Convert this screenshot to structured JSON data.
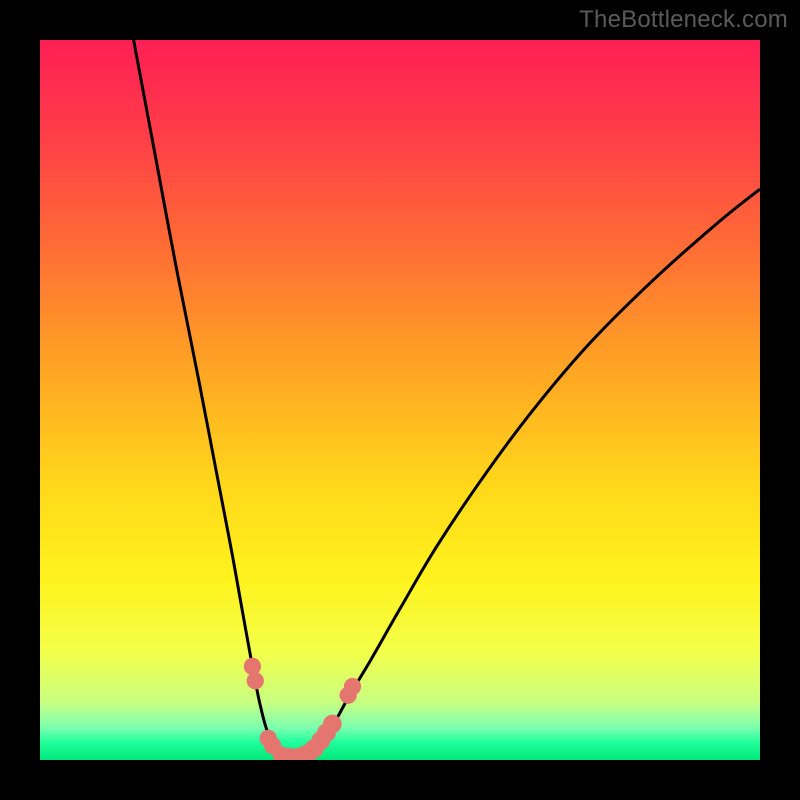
{
  "watermark": "TheBottleneck.com",
  "colors": {
    "frame": "#000000",
    "curve": "#000000",
    "marker": "#e4756f",
    "gradient_stops": [
      {
        "offset": 0.0,
        "color": "#ff1f55"
      },
      {
        "offset": 0.12,
        "color": "#ff3a4a"
      },
      {
        "offset": 0.28,
        "color": "#ff6a36"
      },
      {
        "offset": 0.45,
        "color": "#ffa324"
      },
      {
        "offset": 0.62,
        "color": "#ffd81a"
      },
      {
        "offset": 0.75,
        "color": "#fff31e"
      },
      {
        "offset": 0.85,
        "color": "#f3ff4a"
      },
      {
        "offset": 0.92,
        "color": "#c8ff82"
      },
      {
        "offset": 0.955,
        "color": "#7dffb0"
      },
      {
        "offset": 0.975,
        "color": "#22ff9d"
      },
      {
        "offset": 1.0,
        "color": "#00e87a"
      }
    ]
  },
  "chart_data": {
    "type": "line",
    "title": "",
    "xlabel": "",
    "ylabel": "",
    "xlim": [
      0,
      100
    ],
    "ylim": [
      0,
      100
    ],
    "series": [
      {
        "name": "left-curve",
        "points": [
          {
            "x": 13.0,
            "y": 100.0
          },
          {
            "x": 16.0,
            "y": 84.0
          },
          {
            "x": 19.0,
            "y": 68.0
          },
          {
            "x": 22.0,
            "y": 53.0
          },
          {
            "x": 24.5,
            "y": 40.0
          },
          {
            "x": 26.8,
            "y": 28.0
          },
          {
            "x": 28.5,
            "y": 18.5
          },
          {
            "x": 29.6,
            "y": 12.5
          },
          {
            "x": 30.5,
            "y": 8.0
          },
          {
            "x": 31.5,
            "y": 4.2
          },
          {
            "x": 32.8,
            "y": 1.5
          },
          {
            "x": 34.0,
            "y": 0.4
          },
          {
            "x": 35.2,
            "y": 0.0
          }
        ]
      },
      {
        "name": "right-curve",
        "points": [
          {
            "x": 35.2,
            "y": 0.0
          },
          {
            "x": 36.8,
            "y": 0.4
          },
          {
            "x": 38.5,
            "y": 1.8
          },
          {
            "x": 40.5,
            "y": 4.5
          },
          {
            "x": 43.0,
            "y": 9.0
          },
          {
            "x": 46.0,
            "y": 14.0
          },
          {
            "x": 50.0,
            "y": 21.0
          },
          {
            "x": 55.0,
            "y": 29.5
          },
          {
            "x": 61.0,
            "y": 38.5
          },
          {
            "x": 68.0,
            "y": 48.0
          },
          {
            "x": 76.0,
            "y": 57.5
          },
          {
            "x": 85.0,
            "y": 66.5
          },
          {
            "x": 94.0,
            "y": 74.5
          },
          {
            "x": 100.0,
            "y": 79.3
          }
        ]
      }
    ],
    "markers": [
      {
        "x": 29.5,
        "y": 13.0,
        "r": 1.2
      },
      {
        "x": 29.9,
        "y": 11.0,
        "r": 1.2
      },
      {
        "x": 31.7,
        "y": 3.0,
        "r": 1.2
      },
      {
        "x": 32.3,
        "y": 2.0,
        "r": 1.2
      },
      {
        "x": 33.5,
        "y": 0.7,
        "r": 1.2
      },
      {
        "x": 34.4,
        "y": 0.4,
        "r": 1.3
      },
      {
        "x": 35.4,
        "y": 0.3,
        "r": 1.3
      },
      {
        "x": 36.3,
        "y": 0.5,
        "r": 1.3
      },
      {
        "x": 37.2,
        "y": 0.9,
        "r": 1.3
      },
      {
        "x": 38.1,
        "y": 1.6,
        "r": 1.3
      },
      {
        "x": 39.0,
        "y": 2.7,
        "r": 1.3
      },
      {
        "x": 39.8,
        "y": 3.8,
        "r": 1.3
      },
      {
        "x": 40.6,
        "y": 5.0,
        "r": 1.3
      },
      {
        "x": 42.8,
        "y": 9.0,
        "r": 1.2
      },
      {
        "x": 43.4,
        "y": 10.2,
        "r": 1.2
      }
    ]
  }
}
